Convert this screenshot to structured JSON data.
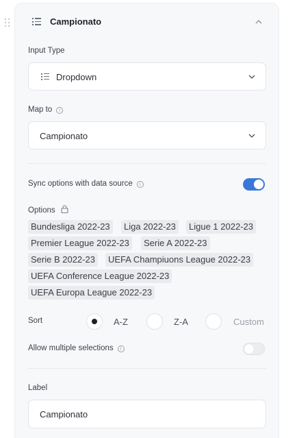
{
  "field": {
    "title": "Campionato"
  },
  "input_type": {
    "label": "Input Type",
    "value": "Dropdown",
    "icon": "list-icon"
  },
  "map_to": {
    "label": "Map to",
    "value": "Campionato"
  },
  "sync": {
    "label": "Sync options with data source",
    "enabled": true
  },
  "options": {
    "label": "Options",
    "items": [
      "Bundesliga 2022-23",
      "Liga 2022-23",
      "Ligue 1 2022-23",
      "Premier League 2022-23",
      "Serie A 2022-23",
      "Serie B 2022-23",
      "UEFA Champiuons League 2022-23",
      "UEFA Conference League 2022-23",
      "UEFA Europa League 2022-23"
    ]
  },
  "sort": {
    "label": "Sort",
    "options": [
      "A-Z",
      "Z-A",
      "Custom"
    ],
    "selected": "A-Z"
  },
  "multiple": {
    "label": "Allow multiple selections",
    "enabled": false
  },
  "label_field": {
    "label": "Label",
    "value": "Campionato"
  },
  "colors": {
    "accent": "#3a78d8",
    "panel": "#f7f8fa"
  }
}
